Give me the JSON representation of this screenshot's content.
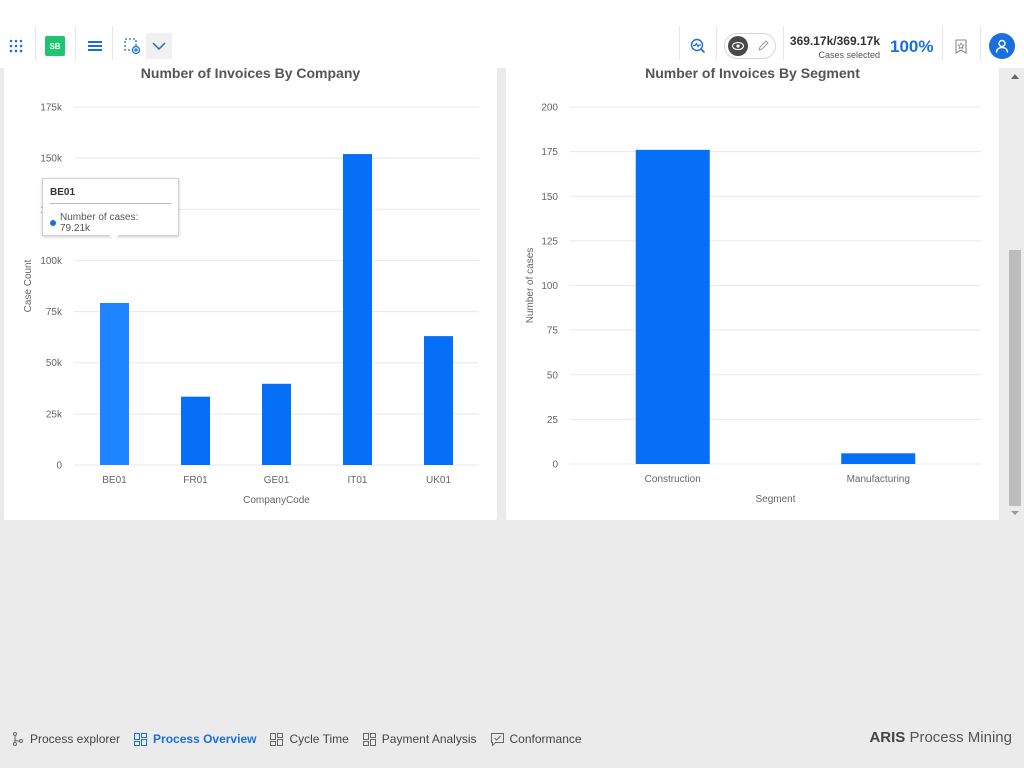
{
  "topbar": {
    "badge_label": "SB",
    "cases_count": "369.17k/369.17k",
    "cases_label": "Cases selected",
    "percent": "100%",
    "icons": [
      "apps-grid-icon",
      "menu-icon",
      "selection-add-icon",
      "chevron-down-icon",
      "analysis-icon",
      "eye-icon",
      "pencil-icon",
      "bookmark-icon",
      "user-icon"
    ]
  },
  "colors": {
    "accent": "#1a6fe0",
    "bar": "#066ff7",
    "bar_highlight": "#1e84ff",
    "badge": "#1fc46e"
  },
  "tooltip": {
    "title": "BE01",
    "label": "Number of cases: 79.21k"
  },
  "chart_data": [
    {
      "type": "bar",
      "title": "Number of Invoices By Company",
      "xlabel": "CompanyCode",
      "ylabel": "Case Count",
      "categories": [
        "BE01",
        "FR01",
        "GE01",
        "IT01",
        "UK01"
      ],
      "values": [
        79210,
        33400,
        39700,
        152000,
        63000
      ],
      "ylim": [
        0,
        175000
      ],
      "yticks": [
        0,
        25000,
        50000,
        75000,
        100000,
        125000,
        150000,
        175000
      ],
      "ytick_labels": [
        "0",
        "25k",
        "50k",
        "75k",
        "100k",
        "125k",
        "150k",
        "175k"
      ],
      "highlighted": "BE01",
      "grid": true,
      "legend": "none"
    },
    {
      "type": "bar",
      "title": "Number of Invoices By Segment",
      "xlabel": "Segment",
      "ylabel": "Number of cases",
      "categories": [
        "Construction",
        "Manufacturing"
      ],
      "values": [
        176,
        6
      ],
      "ylim": [
        0,
        200
      ],
      "yticks": [
        0,
        25,
        50,
        75,
        100,
        125,
        150,
        175,
        200
      ],
      "ytick_labels": [
        "0",
        "25",
        "50",
        "75",
        "100",
        "125",
        "150",
        "175",
        "200"
      ],
      "grid": true,
      "legend": "none"
    }
  ],
  "bottom_tabs": [
    {
      "label": "Process explorer",
      "icon": "process-explorer-icon",
      "active": false
    },
    {
      "label": "Process Overview",
      "icon": "dashboard-icon",
      "active": true
    },
    {
      "label": "Cycle Time",
      "icon": "dashboard-icon",
      "active": false
    },
    {
      "label": "Payment Analysis",
      "icon": "dashboard-icon",
      "active": false
    },
    {
      "label": "Conformance",
      "icon": "conformance-icon",
      "active": false
    }
  ],
  "brand": {
    "bold": "ARIS",
    "rest": " Process Mining"
  }
}
